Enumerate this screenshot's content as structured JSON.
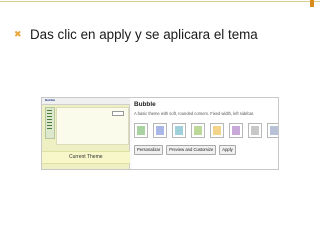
{
  "slide": {
    "bullet_text": "Das clic en apply y se aplicara el tema",
    "bullet_icon": "x-mark-icon",
    "accent_color": "#e8a73c"
  },
  "screenshot": {
    "brand": "Bubble",
    "current_theme_label": "Current Theme",
    "theme_title": "Bubble",
    "theme_description": "A basic theme with soft, rounded corners. Fixed width, left sidebar.",
    "swatch_colors": [
      "#a9d3a1",
      "#a9b8e6",
      "#9fd0dc",
      "#bcd99a",
      "#f2d48a",
      "#c8a9d8",
      "#c8c8c8",
      "#b8c2d6"
    ],
    "buttons": {
      "personalize": "Personalizar",
      "preview_customize": "Preview and Customize",
      "apply": "Apply"
    }
  }
}
